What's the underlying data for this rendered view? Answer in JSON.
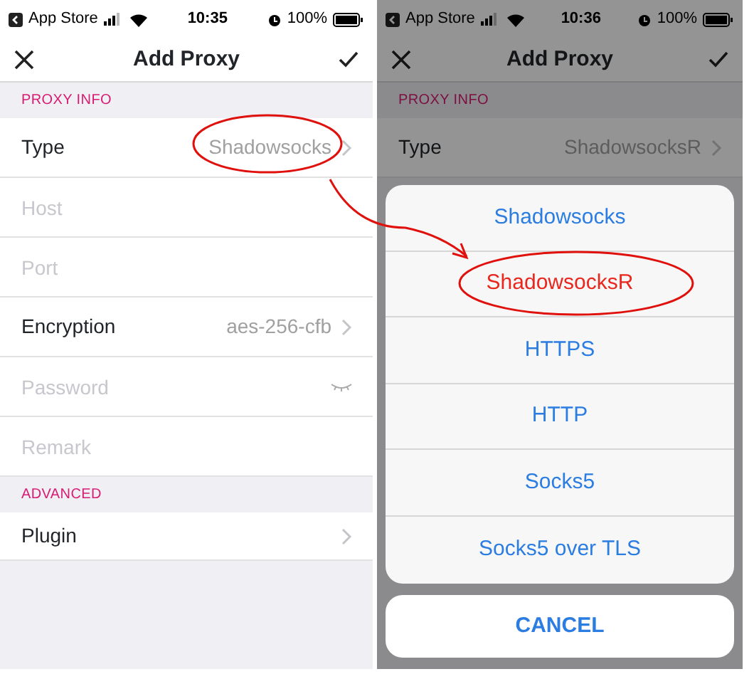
{
  "screens": [
    {
      "status_bar": {
        "back_app": "App Store",
        "time": "10:35",
        "battery": "100%"
      },
      "nav": {
        "title": "Add Proxy"
      },
      "sections": [
        {
          "header": "PROXY INFO",
          "rows": [
            {
              "kind": "value",
              "label": "Type",
              "value": "Shadowsocks"
            },
            {
              "kind": "input",
              "placeholder": "Host"
            },
            {
              "kind": "input",
              "placeholder": "Port"
            },
            {
              "kind": "value",
              "label": "Encryption",
              "value": "aes-256-cfb"
            },
            {
              "kind": "password",
              "placeholder": "Password"
            },
            {
              "kind": "input",
              "placeholder": "Remark"
            }
          ]
        },
        {
          "header": "ADVANCED",
          "rows": [
            {
              "kind": "value",
              "label": "Plugin"
            }
          ]
        }
      ]
    },
    {
      "status_bar": {
        "back_app": "App Store",
        "time": "10:36",
        "battery": "100%"
      },
      "nav": {
        "title": "Add Proxy"
      },
      "sections": [
        {
          "header": "PROXY INFO",
          "rows": [
            {
              "kind": "value",
              "label": "Type",
              "value": "ShadowsocksR"
            }
          ]
        }
      ],
      "action_sheet": {
        "options": [
          {
            "label": "Shadowsocks",
            "selected": false
          },
          {
            "label": "ShadowsocksR",
            "selected": true
          },
          {
            "label": "HTTPS",
            "selected": false
          },
          {
            "label": "HTTP",
            "selected": false
          },
          {
            "label": "Socks5",
            "selected": false
          },
          {
            "label": "Socks5 over TLS",
            "selected": false
          }
        ],
        "cancel": "CANCEL"
      }
    }
  ]
}
